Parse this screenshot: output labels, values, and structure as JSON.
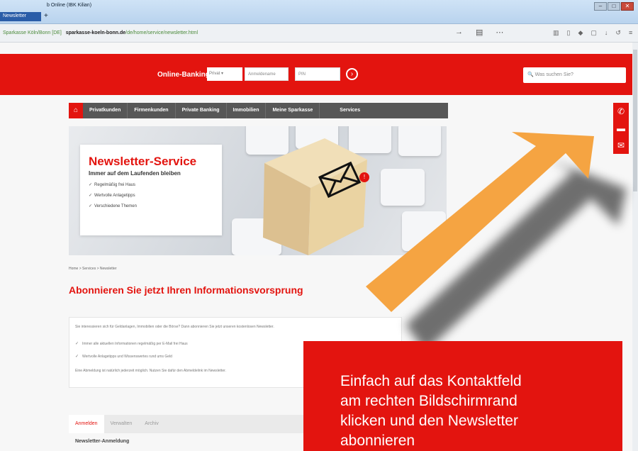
{
  "browser": {
    "tab_title": "b Online (IBK Kilian)",
    "tab_active_label": "Newsletter",
    "url_prefix": "Sparkasse Köln/Bonn [DE]",
    "url_host": "sparkasse-koeln-bonn.de",
    "url_path": "/de/home/service/newsletter.html"
  },
  "header": {
    "online_banking_label": "Online-Banking",
    "select_value": "Privat",
    "field1_placeholder": "Anmeldename",
    "field2_placeholder": "PIN",
    "search_placeholder": "Was suchen Sie?"
  },
  "nav": {
    "items": [
      "Privatkunden",
      "Firmenkunden",
      "Private Banking",
      "Immobilien",
      "Meine Sparkasse",
      "Services"
    ]
  },
  "hero": {
    "title": "Newsletter-Service",
    "subtitle": "Immer auf dem Laufenden bleiben",
    "bullets": [
      "Regelmäßig frei Haus",
      "Wertvolle Anlagetipps",
      "Verschiedene Themen"
    ]
  },
  "content": {
    "breadcrumb": "Home > Services > Newsletter",
    "title": "Abonnieren Sie jetzt Ihren Informationsvorsprung",
    "intro": "Sie interessieren sich für Geldanlagen, Immobilien oder die Börse? Dann abonnieren Sie jetzt unseren kostenlosen Newsletter.",
    "bullets": [
      "Immer alle aktuellen Informationen regelmäßig per E-Mail frei Haus",
      "Wertvolle Anlagetipps und Wissenswertes rund ums Geld"
    ],
    "footer": "Eine Abmeldung ist natürlich jederzeit möglich. Nutzen Sie dafür den Abmeldelink im Newsletter."
  },
  "tabs": [
    "Anmelden",
    "Verwalten",
    "Archiv"
  ],
  "form_heading": "Newsletter-Anmeldung",
  "callout": {
    "line1": "Einfach auf das Kontaktfeld",
    "line2": "am rechten Bildschirmrand",
    "line3": "klicken und den Newsletter",
    "line4": "abonnieren"
  },
  "colors": {
    "brand_red": "#e3140f",
    "arrow_orange": "#f5a442",
    "nav_gray": "#575757"
  },
  "icons": {
    "contact": [
      "phone-icon",
      "chat-icon",
      "mail-icon"
    ]
  }
}
